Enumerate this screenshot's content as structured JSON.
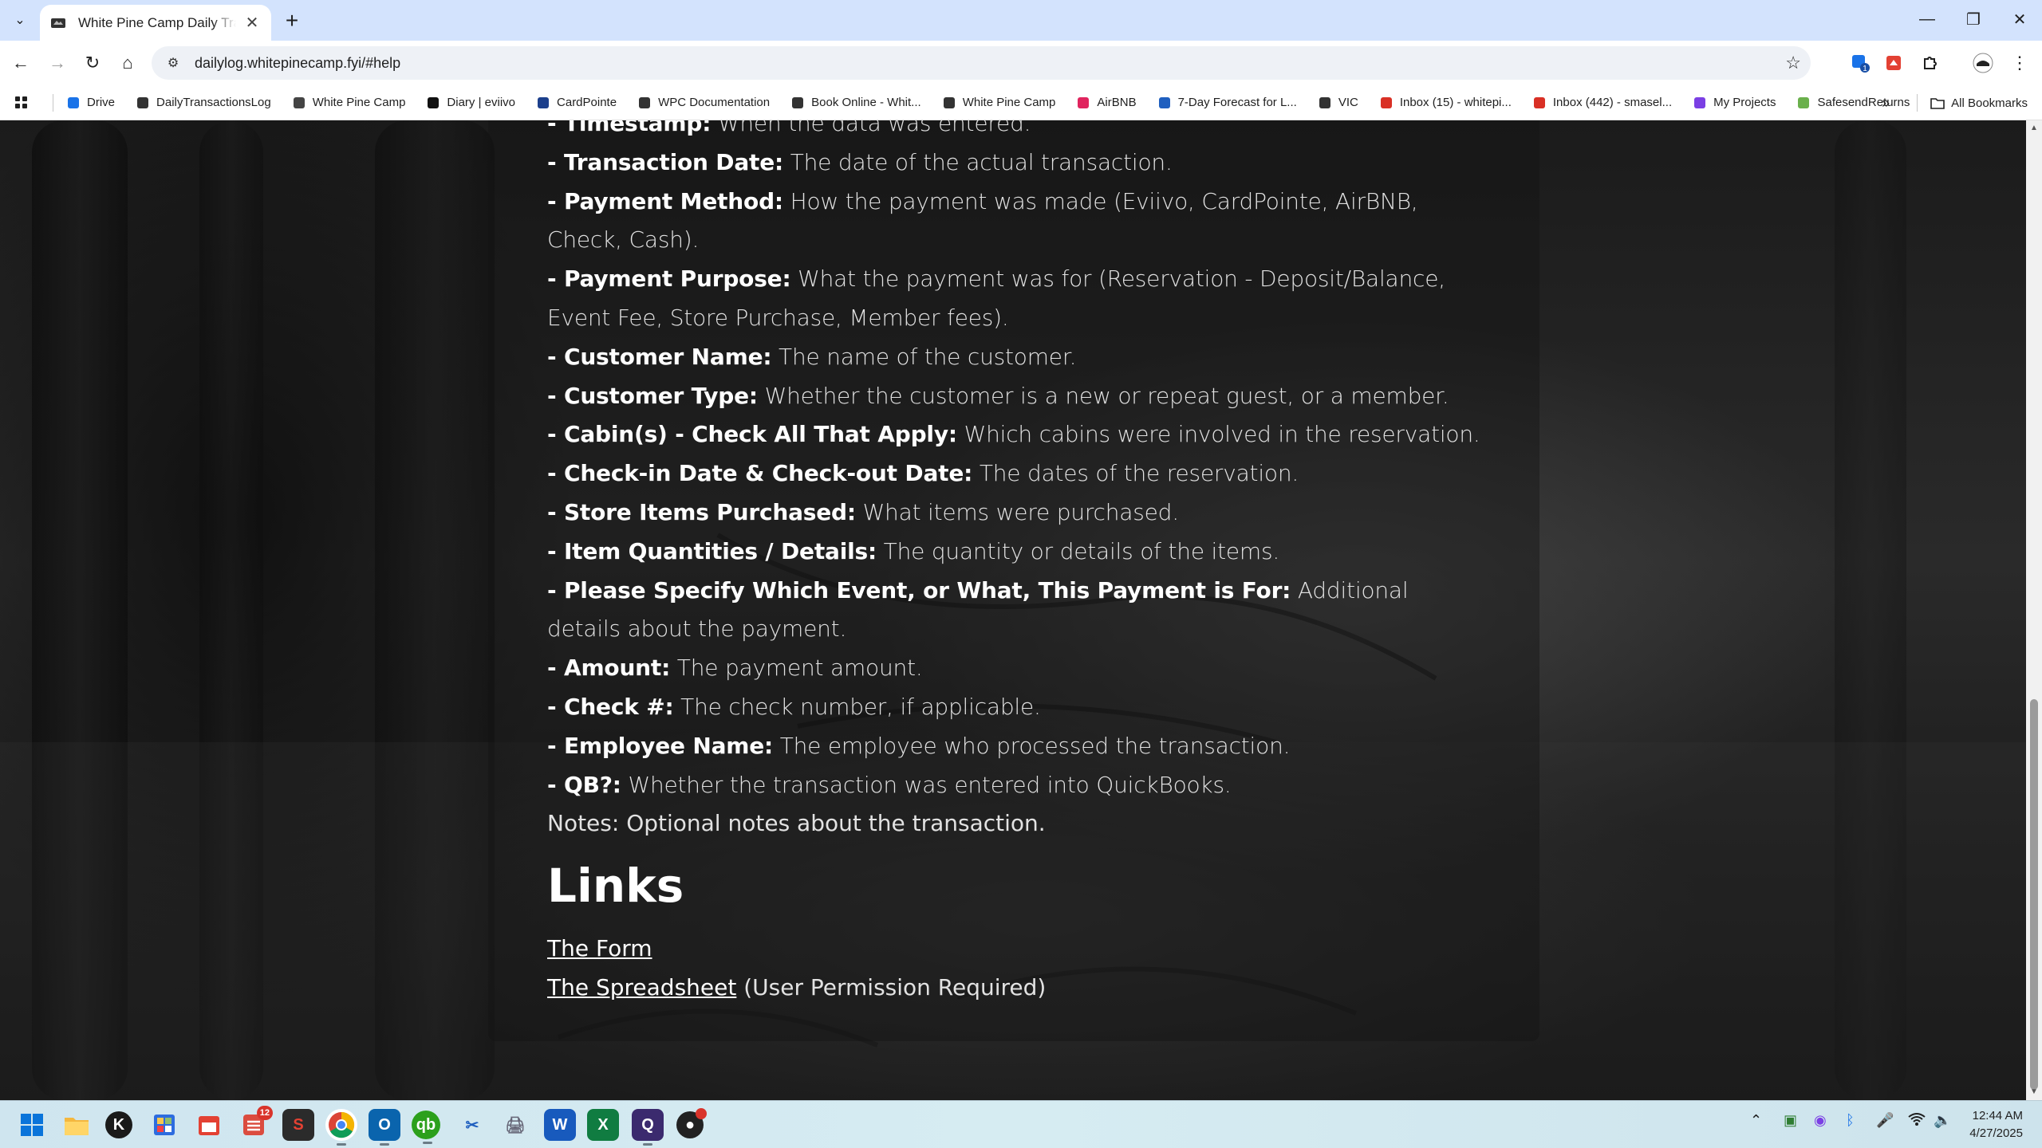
{
  "browser": {
    "tab_title": "White Pine Camp Daily Transactions",
    "url": "dailylog.whitepinecamp.fyi/#help",
    "extension_badge": "1"
  },
  "bookmarks": [
    {
      "label": "Drive",
      "icon": "drive-icon",
      "color": "#1a73e8"
    },
    {
      "label": "DailyTransactionsLog",
      "icon": "site-icon",
      "color": "#333333"
    },
    {
      "label": "White Pine Camp",
      "icon": "folder-icon",
      "color": "#444444"
    },
    {
      "label": "Diary | eviivo",
      "icon": "eviivo-icon",
      "color": "#111111"
    },
    {
      "label": "CardPointe",
      "icon": "cardpointe-icon",
      "color": "#1c3f8c"
    },
    {
      "label": "WPC Documentation",
      "icon": "site-icon",
      "color": "#333333"
    },
    {
      "label": "Book Online - Whit...",
      "icon": "globe-icon",
      "color": "#333333"
    },
    {
      "label": "White Pine Camp",
      "icon": "site-icon",
      "color": "#333333"
    },
    {
      "label": "AirBNB",
      "icon": "airbnb-icon",
      "color": "#e0245e"
    },
    {
      "label": "7-Day Forecast for L...",
      "icon": "weather-icon",
      "color": "#1f5fbf"
    },
    {
      "label": "VIC",
      "icon": "globe-icon",
      "color": "#333333"
    },
    {
      "label": "Inbox (15) - whitepi...",
      "icon": "gmail-icon",
      "color": "#d93025"
    },
    {
      "label": "Inbox (442) - smasel...",
      "icon": "gmail-icon",
      "color": "#d93025"
    },
    {
      "label": "My Projects",
      "icon": "projects-icon",
      "color": "#7b3fe4"
    },
    {
      "label": "SafesendReturns",
      "icon": "safesend-icon",
      "color": "#6ab04c"
    }
  ],
  "all_bookmarks_label": "All Bookmarks",
  "fields": [
    {
      "name": "- Timestamp:",
      "desc": " When the data was entered."
    },
    {
      "name": "- Transaction Date:",
      "desc": " The date of the actual transaction."
    },
    {
      "name": "- Payment Method:",
      "desc": " How the payment was made (Eviivo, CardPointe, AirBNB, Check, Cash)."
    },
    {
      "name": "- Payment Purpose:",
      "desc": " What the payment was for (Reservation - Deposit/Balance, Event Fee, Store Purchase, Member fees)."
    },
    {
      "name": "- Customer Name:",
      "desc": " The name of the customer."
    },
    {
      "name": "- Customer Type:",
      "desc": " Whether the customer is a new or repeat guest, or a member."
    },
    {
      "name": "- Cabin(s) - Check All That Apply:",
      "desc": " Which cabins were involved in the reservation."
    },
    {
      "name": "- Check-in Date & Check-out Date:",
      "desc": " The dates of the reservation."
    },
    {
      "name": "- Store Items Purchased:",
      "desc": " What items were purchased."
    },
    {
      "name": "- Item Quantities / Details:",
      "desc": " The quantity or details of the items."
    },
    {
      "name": "- Please Specify Which Event, or What, This Payment is For:",
      "desc": " Additional details about the payment."
    },
    {
      "name": "- Amount:",
      "desc": " The payment amount."
    },
    {
      "name": "- Check #:",
      "desc": " The check number, if applicable."
    },
    {
      "name": "- Employee Name:",
      "desc": " The employee who processed the transaction."
    },
    {
      "name": "- QB?:",
      "desc": " Whether the transaction was entered into QuickBooks."
    }
  ],
  "notes": "Notes: Optional notes about the transaction.",
  "links": {
    "heading": "Links",
    "form_link": "The Form",
    "spreadsheet_link": "The Spreadsheet",
    "spreadsheet_note": " (User Permission Required)"
  },
  "taskbar": {
    "time": "12:44 AM",
    "date": "4/27/2025",
    "badge_count": "12"
  }
}
